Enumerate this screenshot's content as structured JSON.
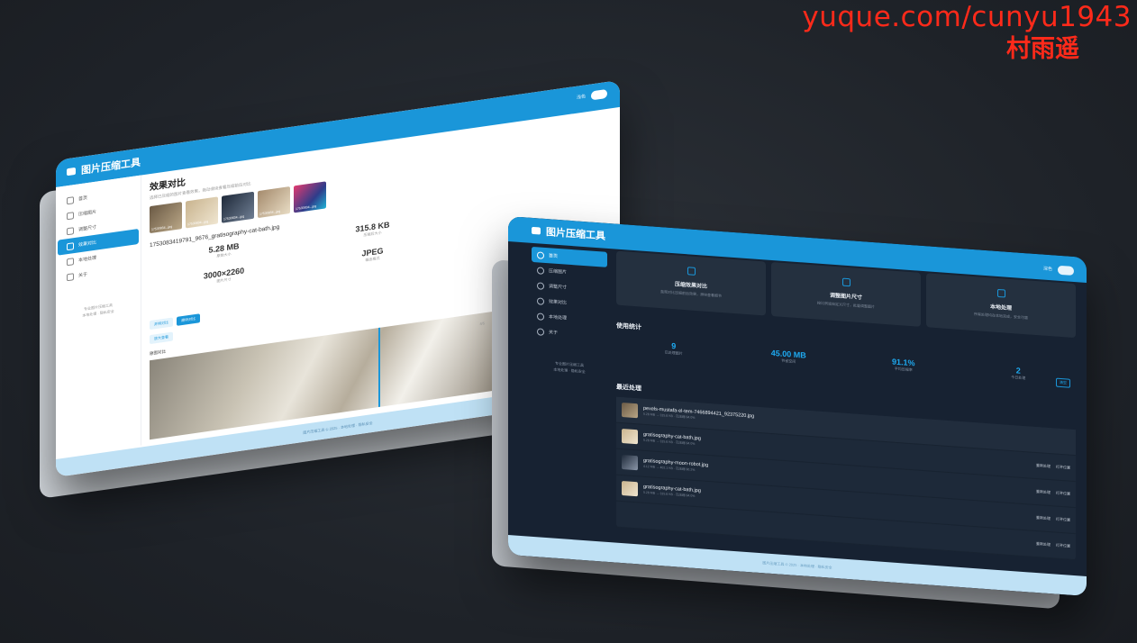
{
  "watermark": {
    "line1": "yuque.com/cunyu1943",
    "line2": "村雨遥"
  },
  "light_window": {
    "title": "图片压缩工具",
    "toggle_label": "浅色",
    "nav": [
      {
        "label": "首页",
        "icon": "home-icon"
      },
      {
        "label": "压缩图片",
        "icon": "compress-icon"
      },
      {
        "label": "调整尺寸",
        "icon": "resize-icon"
      },
      {
        "label": "效果对比",
        "icon": "compare-icon"
      },
      {
        "label": "本地处理",
        "icon": "local-icon"
      },
      {
        "label": "关于",
        "icon": "info-icon"
      }
    ],
    "side_footer_1": "专业图片压缩工具",
    "side_footer_2": "本地处理 · 隐私安全",
    "heading": "效果对比",
    "subtitle": "选择已压缩的图片查看效果，拖动滑块查看压缩前后对比",
    "thumbs": [
      "17530834...jpg",
      "17530834...jpg",
      "17530834...jpg",
      "17530834...jpg",
      "17530834...jpg"
    ],
    "file_name": "1753083419791_9676_gratisography-cat-bath.jpg",
    "stats": [
      {
        "value": "5.28 MB",
        "label": "原始大小"
      },
      {
        "value": "315.8 KB",
        "label": "压缩后大小"
      },
      {
        "value": "3000×2260",
        "label": "图片尺寸"
      },
      {
        "value": "JPEG",
        "label": "输出格式"
      }
    ],
    "mode_buttons": [
      "并排对比",
      "滑块对比"
    ],
    "zoom_button": "放大查看",
    "page_indicator": "4/5",
    "compare_label": "原图对比",
    "footer": "图片压缩工具 © 2025 · 本地处理 · 隐私安全"
  },
  "dark_window": {
    "title": "图片压缩工具",
    "toggle_label": "深色",
    "nav": [
      {
        "label": "首页",
        "icon": "home-icon"
      },
      {
        "label": "压缩图片",
        "icon": "compress-icon"
      },
      {
        "label": "调整尺寸",
        "icon": "resize-icon"
      },
      {
        "label": "效果对比",
        "icon": "compare-icon"
      },
      {
        "label": "本地处理",
        "icon": "local-icon"
      },
      {
        "label": "关于",
        "icon": "info-icon"
      }
    ],
    "side_footer_1": "专业图片压缩工具",
    "side_footer_2": "本地处理 · 隐私安全",
    "feature_cards": [
      {
        "title": "压缩效果对比",
        "desc": "直观对比压缩前后效果，滑块查看细节"
      },
      {
        "title": "调整图片尺寸",
        "desc": "按比例或自定义尺寸，批量调整图片"
      },
      {
        "title": "本地处理",
        "desc": "所有处理均在本地完成，安全可靠"
      }
    ],
    "usage_title": "使用统计",
    "usage": [
      {
        "value": "9",
        "label": "已处理图片"
      },
      {
        "value": "45.00 MB",
        "label": "节省空间"
      },
      {
        "value": "91.1%",
        "label": "平均压缩率"
      },
      {
        "value": "2",
        "label": "今日处理"
      }
    ],
    "usage_button": "清空",
    "recent_title": "最近处理",
    "recent": [
      {
        "name": "pexels-mustafa-el-tem-7466894421_92375220.jpg",
        "meta": "5.28 MB → 315.8 KB · 已压缩 94.0%",
        "actions": []
      },
      {
        "name": "gratisography-cat-bath.jpg",
        "meta": "5.28 MB → 315.8 KB · 已压缩 94.0%",
        "actions": [
          "重新处理",
          "打开位置"
        ]
      },
      {
        "name": "gratisography-moon-robot.jpg",
        "meta": "4.12 MB → 402.1 KB · 已压缩 90.2%",
        "actions": [
          "重新处理",
          "打开位置"
        ]
      },
      {
        "name": "gratisography-cat-bath.jpg",
        "meta": "5.28 MB → 315.8 KB · 已压缩 94.0%",
        "actions": [
          "重新处理",
          "打开位置"
        ]
      },
      {
        "name": "",
        "meta": "",
        "actions": [
          "重新处理",
          "打开位置"
        ]
      }
    ],
    "footer": "图片压缩工具 © 2025 · 本地处理 · 隐私安全"
  }
}
